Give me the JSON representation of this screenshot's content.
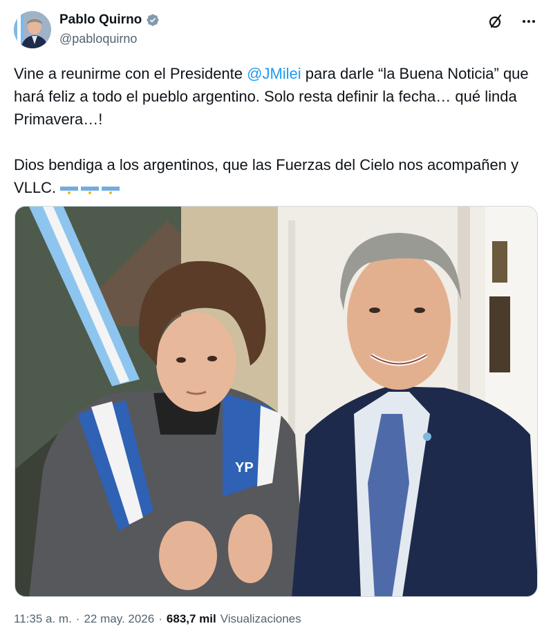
{
  "author": {
    "name": "Pablo Quirno",
    "handle": "@pabloquirno"
  },
  "header": {
    "icons": [
      "grok-icon",
      "more-icon"
    ]
  },
  "tweet": {
    "line1_before": "Vine a reunirme con el Presidente ",
    "mention": "@JMilei",
    "line1_after": " para darle “la Buena Noticia” que hará feliz a todo el pueblo argentino. Solo resta definir la fecha… qué linda Primavera…!",
    "paragraph2": "Dios bendiga a los argentinos, que las Fuerzas del  Cielo nos acompañen y VLLC.",
    "flag_count": 3
  },
  "photo": {
    "jacket_text": "YP"
  },
  "meta": {
    "time": "11:35 a. m.",
    "separator1": "·",
    "date": "22 may. 2026",
    "separator2": "·",
    "views_count": "683,7 mil",
    "views_label": "Visualizaciones"
  },
  "colors": {
    "accent": "#1d9bf0",
    "text": "#0f1419",
    "secondary": "#536471",
    "verified": "#829aab"
  }
}
